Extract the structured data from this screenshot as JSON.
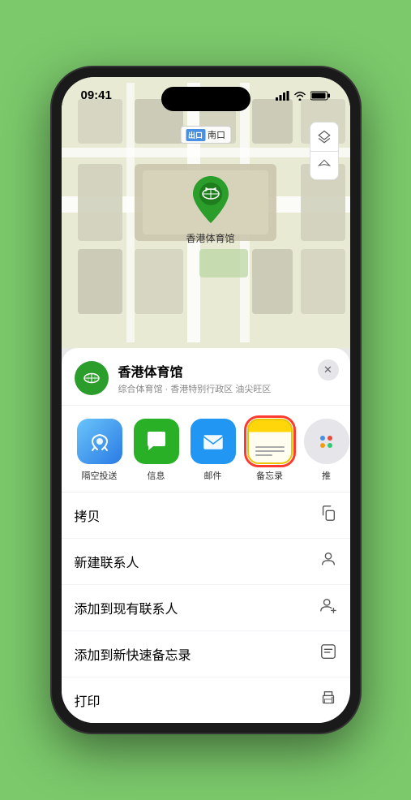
{
  "status_bar": {
    "time": "09:41",
    "signal_bars": "▌▌▌",
    "wifi": "WiFi",
    "battery": "Battery"
  },
  "map": {
    "label_badge": "出口",
    "label_text": "南口",
    "controls": {
      "layers_icon": "🗺",
      "location_icon": "➤"
    },
    "marker_label": "香港体育馆"
  },
  "venue": {
    "name": "香港体育馆",
    "description": "综合体育馆 · 香港特别行政区 油尖旺区",
    "close_label": "×"
  },
  "share_apps": [
    {
      "id": "airdrop",
      "label": "隔空投送",
      "type": "airdrop"
    },
    {
      "id": "messages",
      "label": "信息",
      "type": "messages"
    },
    {
      "id": "mail",
      "label": "邮件",
      "type": "mail"
    },
    {
      "id": "notes",
      "label": "备忘录",
      "type": "notes",
      "selected": true
    },
    {
      "id": "more",
      "label": "推",
      "type": "more"
    }
  ],
  "actions": [
    {
      "id": "copy",
      "label": "拷贝",
      "icon": "copy"
    },
    {
      "id": "new-contact",
      "label": "新建联系人",
      "icon": "person"
    },
    {
      "id": "add-contact",
      "label": "添加到现有联系人",
      "icon": "person-add"
    },
    {
      "id": "quick-note",
      "label": "添加到新快速备忘录",
      "icon": "note"
    },
    {
      "id": "print",
      "label": "打印",
      "icon": "print"
    }
  ]
}
